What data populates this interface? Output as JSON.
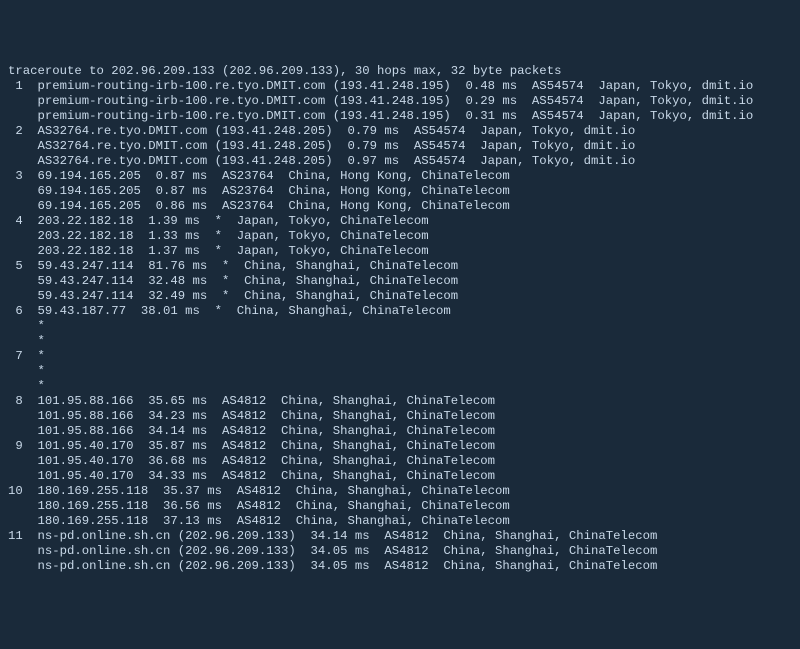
{
  "header": "traceroute to 202.96.209.133 (202.96.209.133), 30 hops max, 32 byte packets",
  "hops": [
    {
      "num": "1",
      "lines": [
        "premium-routing-irb-100.re.tyo.DMIT.com (193.41.248.195)  0.48 ms  AS54574  Japan, Tokyo, dmit.io",
        "premium-routing-irb-100.re.tyo.DMIT.com (193.41.248.195)  0.29 ms  AS54574  Japan, Tokyo, dmit.io",
        "premium-routing-irb-100.re.tyo.DMIT.com (193.41.248.195)  0.31 ms  AS54574  Japan, Tokyo, dmit.io"
      ]
    },
    {
      "num": "2",
      "lines": [
        "AS32764.re.tyo.DMIT.com (193.41.248.205)  0.79 ms  AS54574  Japan, Tokyo, dmit.io",
        "AS32764.re.tyo.DMIT.com (193.41.248.205)  0.79 ms  AS54574  Japan, Tokyo, dmit.io",
        "AS32764.re.tyo.DMIT.com (193.41.248.205)  0.97 ms  AS54574  Japan, Tokyo, dmit.io"
      ]
    },
    {
      "num": "3",
      "lines": [
        "69.194.165.205  0.87 ms  AS23764  China, Hong Kong, ChinaTelecom",
        "69.194.165.205  0.87 ms  AS23764  China, Hong Kong, ChinaTelecom",
        "69.194.165.205  0.86 ms  AS23764  China, Hong Kong, ChinaTelecom"
      ]
    },
    {
      "num": "4",
      "lines": [
        "203.22.182.18  1.39 ms  *  Japan, Tokyo, ChinaTelecom",
        "203.22.182.18  1.33 ms  *  Japan, Tokyo, ChinaTelecom",
        "203.22.182.18  1.37 ms  *  Japan, Tokyo, ChinaTelecom"
      ]
    },
    {
      "num": "5",
      "lines": [
        "59.43.247.114  81.76 ms  *  China, Shanghai, ChinaTelecom",
        "59.43.247.114  32.48 ms  *  China, Shanghai, ChinaTelecom",
        "59.43.247.114  32.49 ms  *  China, Shanghai, ChinaTelecom"
      ]
    },
    {
      "num": "6",
      "lines": [
        "59.43.187.77  38.01 ms  *  China, Shanghai, ChinaTelecom",
        "*",
        "*"
      ]
    },
    {
      "num": "7",
      "lines": [
        "*",
        "*",
        "*"
      ]
    },
    {
      "num": "8",
      "lines": [
        "101.95.88.166  35.65 ms  AS4812  China, Shanghai, ChinaTelecom",
        "101.95.88.166  34.23 ms  AS4812  China, Shanghai, ChinaTelecom",
        "101.95.88.166  34.14 ms  AS4812  China, Shanghai, ChinaTelecom"
      ]
    },
    {
      "num": "9",
      "lines": [
        "101.95.40.170  35.87 ms  AS4812  China, Shanghai, ChinaTelecom",
        "101.95.40.170  36.68 ms  AS4812  China, Shanghai, ChinaTelecom",
        "101.95.40.170  34.33 ms  AS4812  China, Shanghai, ChinaTelecom"
      ]
    },
    {
      "num": "10",
      "lines": [
        "180.169.255.118  35.37 ms  AS4812  China, Shanghai, ChinaTelecom",
        "180.169.255.118  36.56 ms  AS4812  China, Shanghai, ChinaTelecom",
        "180.169.255.118  37.13 ms  AS4812  China, Shanghai, ChinaTelecom"
      ]
    },
    {
      "num": "11",
      "lines": [
        "ns-pd.online.sh.cn (202.96.209.133)  34.14 ms  AS4812  China, Shanghai, ChinaTelecom",
        "ns-pd.online.sh.cn (202.96.209.133)  34.05 ms  AS4812  China, Shanghai, ChinaTelecom",
        "ns-pd.online.sh.cn (202.96.209.133)  34.05 ms  AS4812  China, Shanghai, ChinaTelecom"
      ]
    }
  ]
}
